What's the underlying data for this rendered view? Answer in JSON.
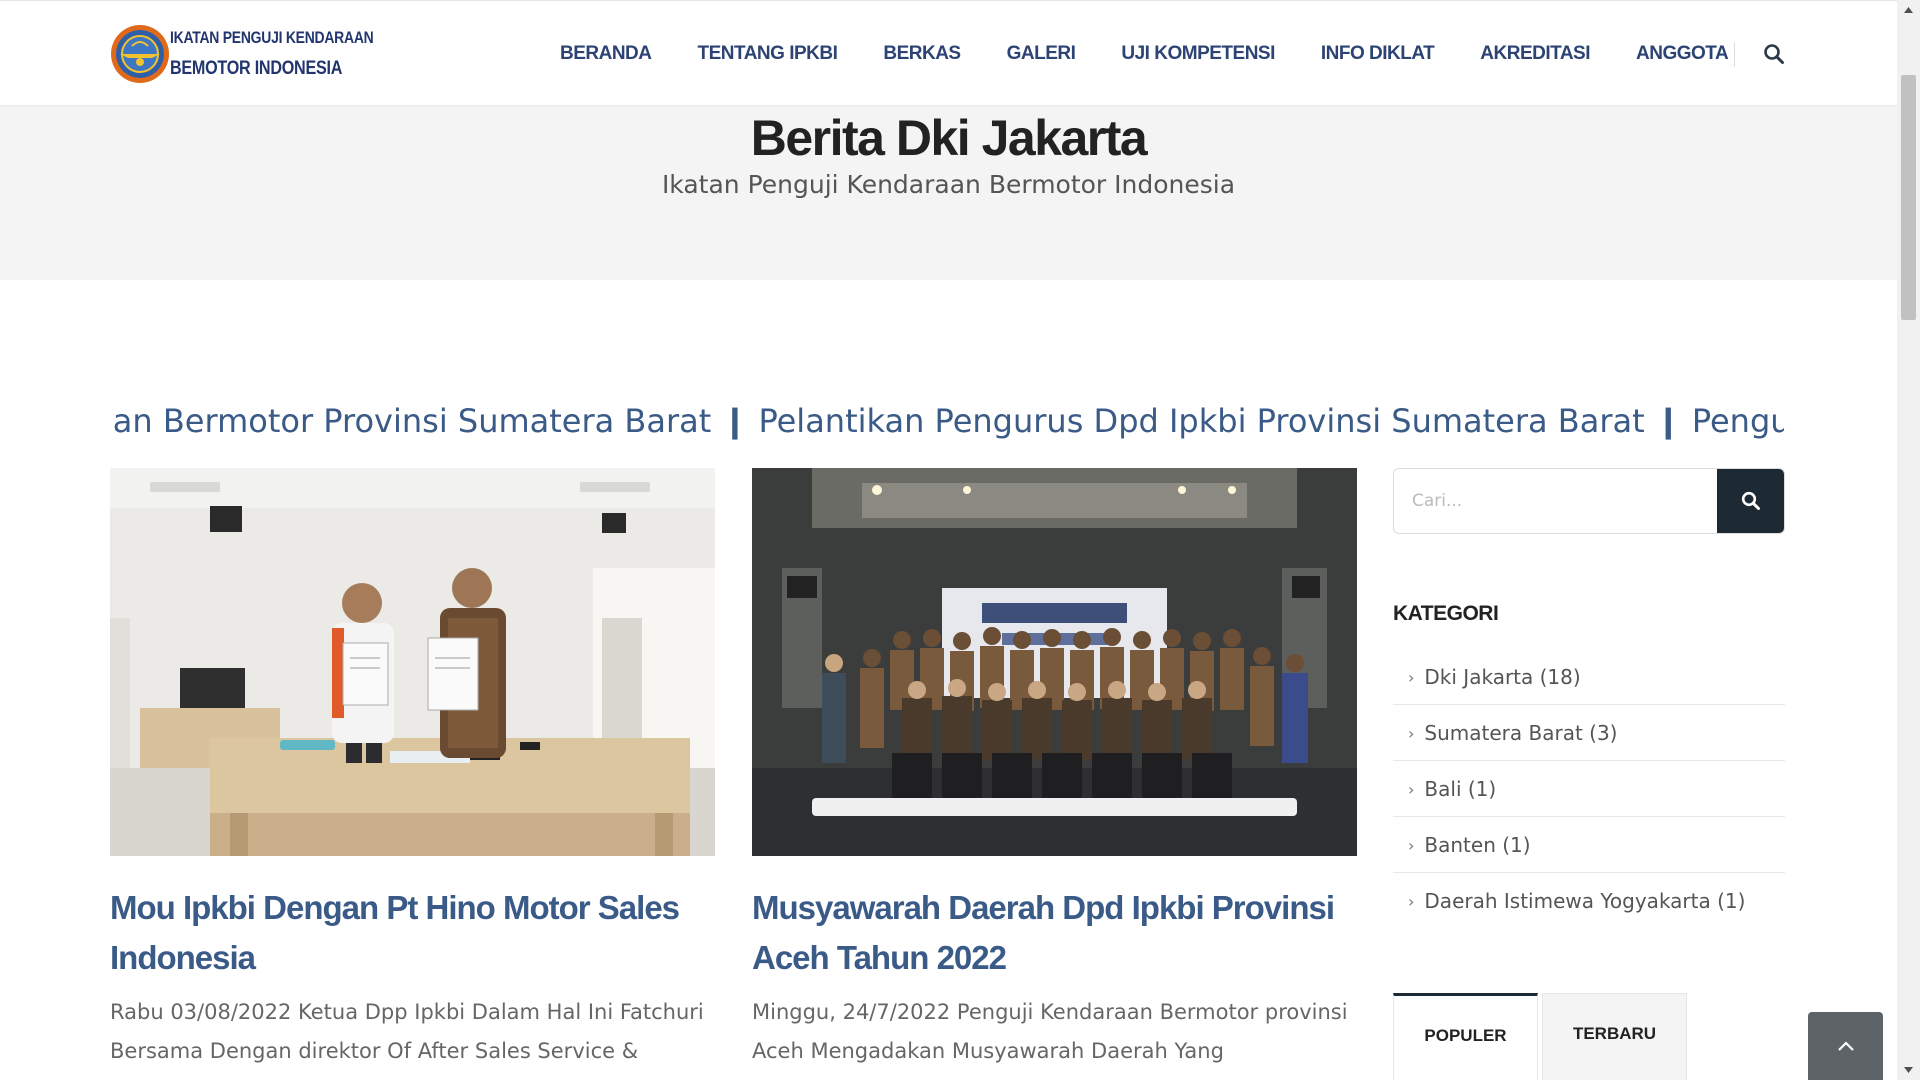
{
  "header": {
    "logo_line1": "IKATAN PENGUJI KENDARAAN",
    "logo_line2": "BEMOTOR INDONESIA",
    "nav": [
      "BERANDA",
      "TENTANG IPKBI",
      "BERKAS",
      "GALERI",
      "UJI KOMPETENSI",
      "INFO DIKLAT",
      "AKREDITASI",
      "ANGGOTA"
    ],
    "search_icon": "search-icon"
  },
  "page": {
    "title": "Berita Dki Jakarta",
    "subtitle": "Ikatan Penguji Kendaraan Bermotor Indonesia"
  },
  "marquee": {
    "text": "raan Bermotor Provinsi Sumatera Barat ❙ Pelantikan Pengurus Dpd Ipkbi Provinsi Sumatera Barat ❙ Penguji M"
  },
  "posts": [
    {
      "title": "Mou Ipkbi Dengan Pt Hino Motor Sales Indonesia",
      "excerpt": "Rabu 03/08/2022 Ketua Dpp Ipkbi Dalam Hal Ini Fatchuri Bersama Dengan direktor Of After Sales Service &"
    },
    {
      "title": "Musyawarah Daerah Dpd Ipkbi Provinsi Aceh Tahun 2022",
      "excerpt": "Minggu, 24/7/2022 Penguji Kendaraan Bermotor provinsi Aceh Mengadakan Musyawarah Daerah Yang"
    }
  ],
  "sidebar": {
    "search_placeholder": "Cari...",
    "categories_heading": "KATEGORI",
    "categories": [
      "Dki Jakarta (18)",
      "Sumatera Barat (3)",
      "Bali (1)",
      "Banten (1)",
      "Daerah Istimewa Yogyakarta (1)"
    ],
    "tabs": [
      "POPULER",
      "TERBARU"
    ]
  },
  "colors": {
    "nav": "#2c4373",
    "link": "#3a5a88",
    "dark": "#1e2a33",
    "band": "#f4f4f4"
  }
}
